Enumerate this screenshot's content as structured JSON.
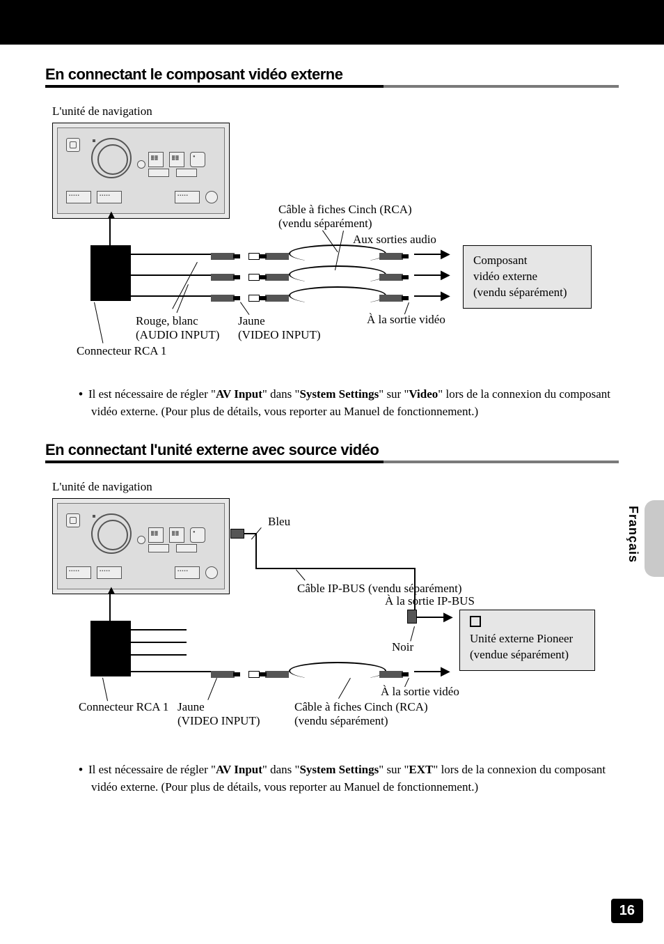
{
  "language_tab": "Français",
  "page_number": "16",
  "section1": {
    "heading": "En connectant le composant vidéo externe",
    "nav_label": "L'unité de navigation",
    "rca_cable": "Câble à fiches Cinch (RCA)",
    "sold_sep": "(vendu séparément)",
    "aux_audio": "Aux sorties audio",
    "to_video_out": "À la sortie vidéo",
    "red_white": "Rouge, blanc",
    "audio_input": "(AUDIO INPUT)",
    "yellow": "Jaune",
    "video_input": "(VIDEO INPUT)",
    "rca_conn": "Connecteur RCA 1",
    "ext_comp_l1": "Composant",
    "ext_comp_l2": "vidéo externe",
    "ext_comp_l3": "(vendu séparément)",
    "note_pre": "Il est nécessaire de régler \"",
    "note_b1": "AV Input",
    "note_mid1": "\" dans \"",
    "note_b2": "System Settings",
    "note_mid2": "\" sur \"",
    "note_b3": "Video",
    "note_post": "\" lors de la connexion du composant vidéo externe. (Pour plus de détails, vous reporter au Manuel de fonctionnement.)"
  },
  "section2": {
    "heading": "En connectant l'unité externe avec source vidéo",
    "nav_label": "L'unité de navigation",
    "blue": "Bleu",
    "ipbus_cable": "Câble IP-BUS (vendu séparément)",
    "to_ipbus": "À la sortie IP-BUS",
    "black": "Noir",
    "to_video_out": "À la sortie vidéo",
    "rca_conn": "Connecteur RCA 1",
    "yellow": "Jaune",
    "video_input": "(VIDEO INPUT)",
    "rca_cable": "Câble à fiches Cinch (RCA)",
    "sold_sep": "(vendu séparément)",
    "ext_unit_l1": "Unité externe Pioneer",
    "ext_unit_l2": "(vendue séparément)",
    "note_pre": "Il est nécessaire de régler \"",
    "note_b1": "AV Input",
    "note_mid1": "\" dans \"",
    "note_b2": "System Settings",
    "note_mid2": "\" sur \"",
    "note_b3": "EXT",
    "note_post": "\" lors de la connexion du composant vidéo externe. (Pour plus de détails, vous reporter au Manuel de fonctionnement.)"
  }
}
